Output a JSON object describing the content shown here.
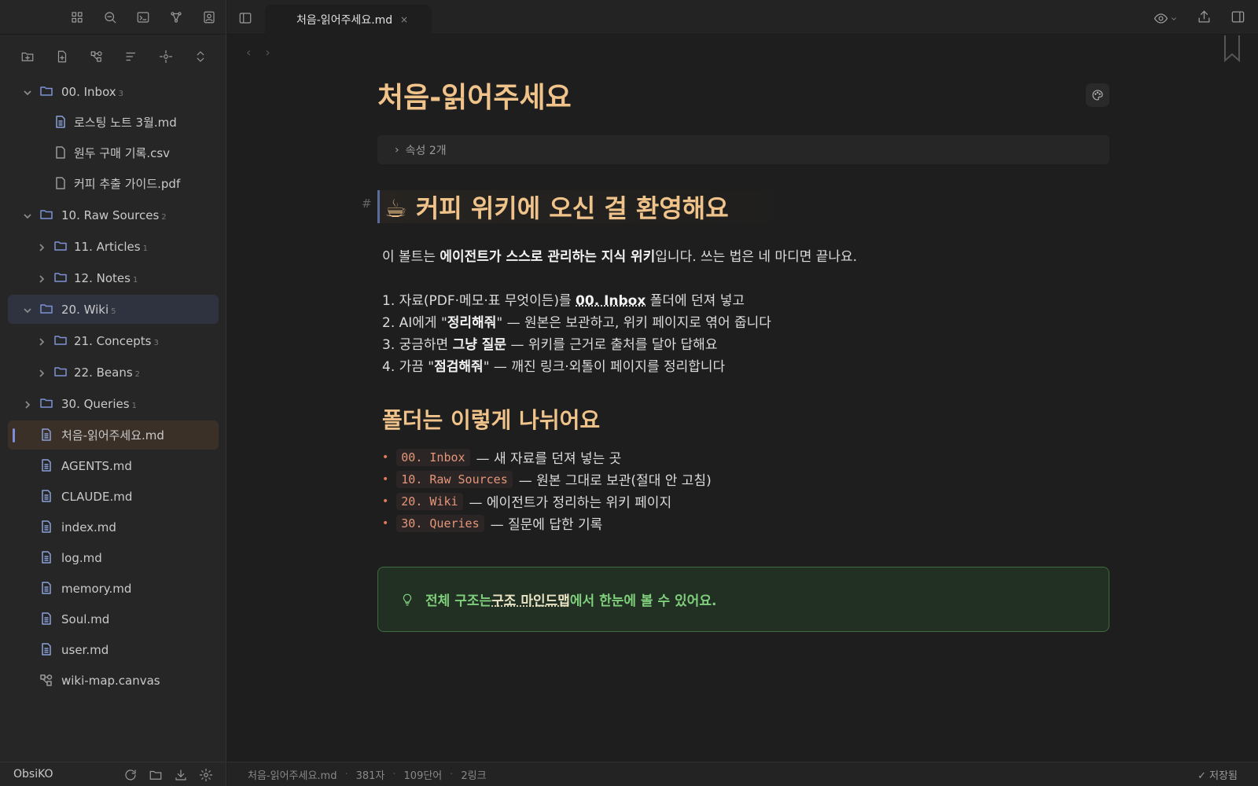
{
  "app": {
    "vault_name": "ObsiKO"
  },
  "tab": {
    "title": "처음-읽어주세요.md",
    "close": "×"
  },
  "tree": {
    "items": [
      {
        "label": "00. Inbox",
        "count": "3"
      },
      {
        "label": "로스팅 노트 3월.md"
      },
      {
        "label": "원두 구매 기록.csv"
      },
      {
        "label": "커피 추출 가이드.pdf"
      },
      {
        "label": "10. Raw Sources",
        "count": "2"
      },
      {
        "label": "11. Articles",
        "count": "1"
      },
      {
        "label": "12. Notes",
        "count": "1"
      },
      {
        "label": "20. Wiki",
        "count": "5"
      },
      {
        "label": "21. Concepts",
        "count": "3"
      },
      {
        "label": "22. Beans",
        "count": "2"
      },
      {
        "label": "30. Queries",
        "count": "1"
      },
      {
        "label": "처음-읽어주세요.md"
      },
      {
        "label": "AGENTS.md"
      },
      {
        "label": "CLAUDE.md"
      },
      {
        "label": "index.md"
      },
      {
        "label": "log.md"
      },
      {
        "label": "memory.md"
      },
      {
        "label": "Soul.md"
      },
      {
        "label": "user.md"
      },
      {
        "label": "wiki-map.canvas"
      }
    ]
  },
  "doc": {
    "title": "처음-읽어주세요",
    "properties": "속성 2개",
    "h1": "☕ 커피 위키에 오신 걸 환영해요",
    "intro_pre": "이 볼트는 ",
    "intro_bold": "에이전트가 스스로 관리하는 지식 위키",
    "intro_post": "입니다. 쓰는 법은 네 마디면 끝나요.",
    "step1_pre": "1. 자료(PDF·메모·표 무엇이든)를 ",
    "step1_link": "00. Inbox",
    "step1_post": " 폴더에 던져 넣고",
    "step2_pre": "2. AI에게 \"",
    "step2_bold": "정리해줘",
    "step2_post": "\" — 원본은 보관하고, 위키 페이지로 엮어 줍니다",
    "step3_pre": "3. 궁금하면 ",
    "step3_bold": "그냥 질문",
    "step3_post": " — 위키를 근거로 출처를 달아 답해요",
    "step4_pre": "4. 가끔 \"",
    "step4_bold": "점검해줘",
    "step4_post": "\" — 깨진 링크·외톨이 페이지를 정리합니다",
    "h2": "폴더는 이렇게 나뉘어요",
    "bullets": [
      {
        "code": "00. Inbox",
        "text": "— 새 자료를 던져 넣는 곳"
      },
      {
        "code": "10. Raw Sources",
        "text": "— 원본 그대로 보관(절대 안 고침)"
      },
      {
        "code": "20. Wiki",
        "text": "— 에이전트가 정리하는 위키 페이지"
      },
      {
        "code": "30. Queries",
        "text": "— 질문에 답한 기록"
      }
    ],
    "callout_pre": "전체 구조는 ",
    "callout_link": "구조 마인드맵",
    "callout_post": "에서 한눈에 볼 수 있어요."
  },
  "status": {
    "file": "처음-읽어주세요.md",
    "chars": "381자",
    "words": "109단어",
    "links": "2링크",
    "saved": "✓ 저장됨"
  },
  "colors": {
    "accent": "#f0c38b",
    "folder": "#7b92d6",
    "callout": "#7fcf7c",
    "code": "#e5967a"
  }
}
